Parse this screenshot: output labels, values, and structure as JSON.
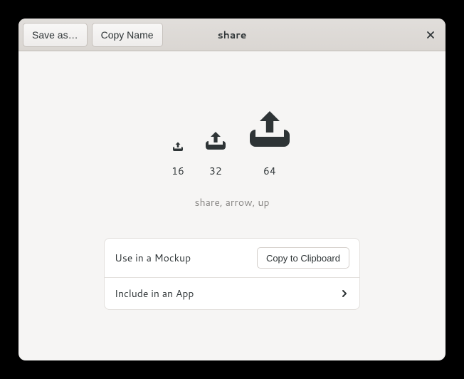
{
  "header": {
    "save_as_label": "Save as…",
    "copy_name_label": "Copy Name",
    "title": "share"
  },
  "preview": {
    "sizes": [
      "16",
      "32",
      "64"
    ],
    "tags": "share, arrow, up"
  },
  "actions": {
    "mockup_label": "Use in a Mockup",
    "copy_clipboard_label": "Copy to Clipboard",
    "include_app_label": "Include in an App"
  }
}
